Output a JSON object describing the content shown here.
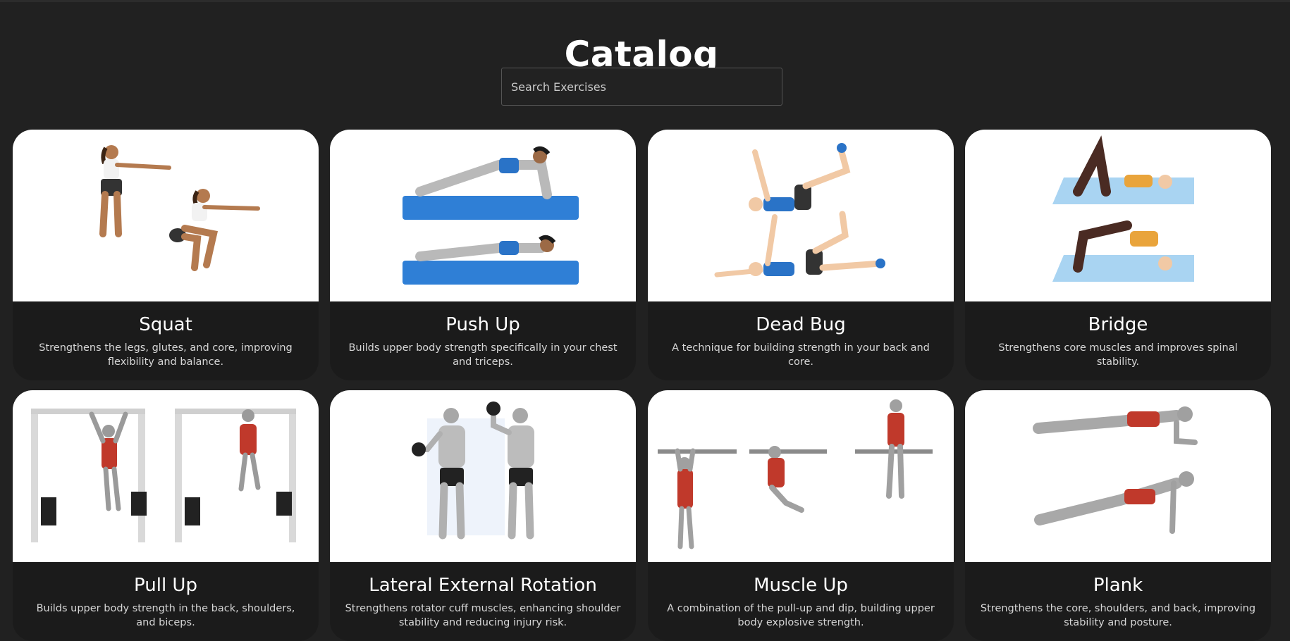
{
  "page": {
    "title": "Catalog",
    "search_placeholder": "Search Exercises",
    "accent_mat_blue": "#2f7fd6",
    "card_background": "#1b1b1b",
    "page_background": "#212121"
  },
  "exercises": [
    {
      "name": "Squat",
      "description": "Strengthens the legs, glutes, and core, improving flexibility and balance.",
      "icon": "squat-illustration"
    },
    {
      "name": "Push Up",
      "description": "Builds upper body strength specifically in your chest and triceps.",
      "icon": "push-up-illustration"
    },
    {
      "name": "Dead Bug",
      "description": "A technique for building strength in your back and core.",
      "icon": "dead-bug-illustration"
    },
    {
      "name": "Bridge",
      "description": "Strengthens core muscles and improves spinal stability.",
      "icon": "bridge-illustration"
    },
    {
      "name": "Pull Up",
      "description": "Builds upper body strength in the back, shoulders, and biceps.",
      "icon": "pull-up-illustration"
    },
    {
      "name": "Lateral External Rotation",
      "description": "Strengthens rotator cuff muscles, enhancing shoulder stability and reducing injury risk.",
      "icon": "lateral-external-rotation-illustration"
    },
    {
      "name": "Muscle Up",
      "description": "A combination of the pull-up and dip, building upper body explosive strength.",
      "icon": "muscle-up-illustration"
    },
    {
      "name": "Plank",
      "description": "Strengthens the core, shoulders, and back, improving stability and posture.",
      "icon": "plank-illustration"
    }
  ]
}
